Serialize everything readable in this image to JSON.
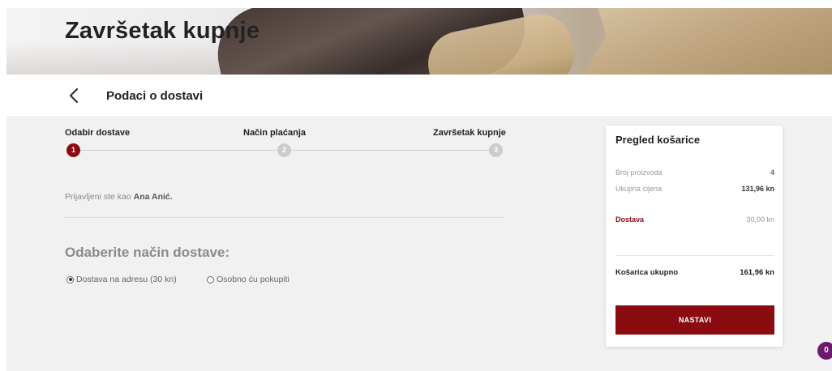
{
  "hero": {
    "title": "Završetak kupnje"
  },
  "subheader": {
    "title": "Podaci o dostavi",
    "back_icon": "chevron-left-icon"
  },
  "steps": [
    {
      "label": "Odabir dostave",
      "number": "1",
      "state": "active"
    },
    {
      "label": "Način plaćanja",
      "number": "2",
      "state": "inactive"
    },
    {
      "label": "Završetak kupnje",
      "number": "3",
      "state": "inactive"
    }
  ],
  "login": {
    "prefix": "Prijavljeni ste kao",
    "name": "Ana Anić."
  },
  "delivery": {
    "title": "Odaberite način dostave:",
    "options": [
      {
        "label": "Dostava na adresu (30 kn)",
        "selected": true
      },
      {
        "label": "Osobno ću pokupiti",
        "selected": false
      }
    ]
  },
  "cart": {
    "title": "Pregled košarice",
    "items_label": "Broj proizvoda",
    "items_value": "4",
    "subtotal_label": "Ukupna cijena",
    "subtotal_value": "131,96 kn",
    "delivery_label": "Dostava",
    "delivery_value": "30,00 kn",
    "total_label": "Košarica ukupno",
    "total_value": "161,96 kn",
    "button_label": "NASTAVI"
  },
  "chat": {
    "count": "0"
  },
  "colors": {
    "accent": "#8a0b10",
    "badge": "#6d1a6e",
    "panel": "#f1f1f1"
  }
}
